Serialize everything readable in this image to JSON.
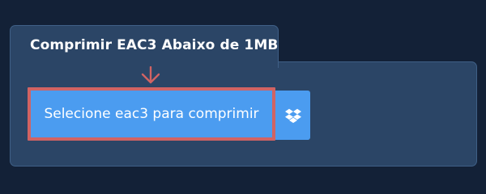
{
  "panel": {
    "tab_title": "Comprimir EAC3 Abaixo de 1MB"
  },
  "actions": {
    "select_button_label": "Selecione eac3 para comprimir"
  },
  "icons": {
    "arrow": "arrow-down-icon",
    "dropbox": "dropbox-icon"
  },
  "colors": {
    "page_bg": "#132137",
    "panel_bg": "#2b4566",
    "panel_border": "#3f5f86",
    "primary_blue": "#4b9cf0",
    "highlight_red": "#d16363",
    "text_white": "#ffffff"
  }
}
